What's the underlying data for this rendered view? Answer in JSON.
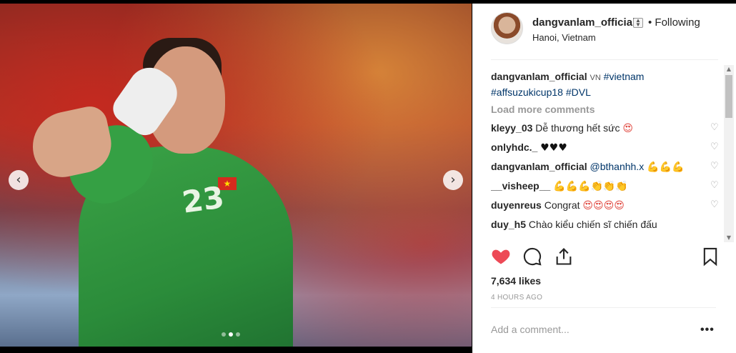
{
  "post": {
    "author": "dangvanlam_official",
    "follow_status": "• Following",
    "location": "Hanoi, Vietnam",
    "jersey_number": "23"
  },
  "caption": {
    "username": "dangvanlam_official",
    "country_badge": "VN",
    "hashtags": [
      "#vietnam",
      "#affsuzukicup18",
      "#DVL"
    ]
  },
  "load_more_label": "Load more comments",
  "comments": [
    {
      "user": "kleyy_03",
      "text": "Dễ thương hết sức",
      "emoji": "😍"
    },
    {
      "user": "onlyhdc._",
      "text": "",
      "emoji": "♥♥♥"
    },
    {
      "user": "dangvanlam_official",
      "text": "@bthanhh.x",
      "emoji": "💪💪💪"
    },
    {
      "user": "__visheep__",
      "text": "",
      "emoji": "💪💪💪👏👏👏"
    },
    {
      "user": "duyenreus",
      "text": "Congrat",
      "emoji": "😍😍😍😍"
    },
    {
      "user": "duy_h5",
      "text": "Chào kiểu chiến sĩ chiến đấu",
      "emoji": ""
    }
  ],
  "likes": "7,634 likes",
  "timestamp": "4 HOURS AGO",
  "add_comment_placeholder": "Add a comment...",
  "more_label": "•••",
  "carousel": {
    "total": 3,
    "active": 2
  }
}
